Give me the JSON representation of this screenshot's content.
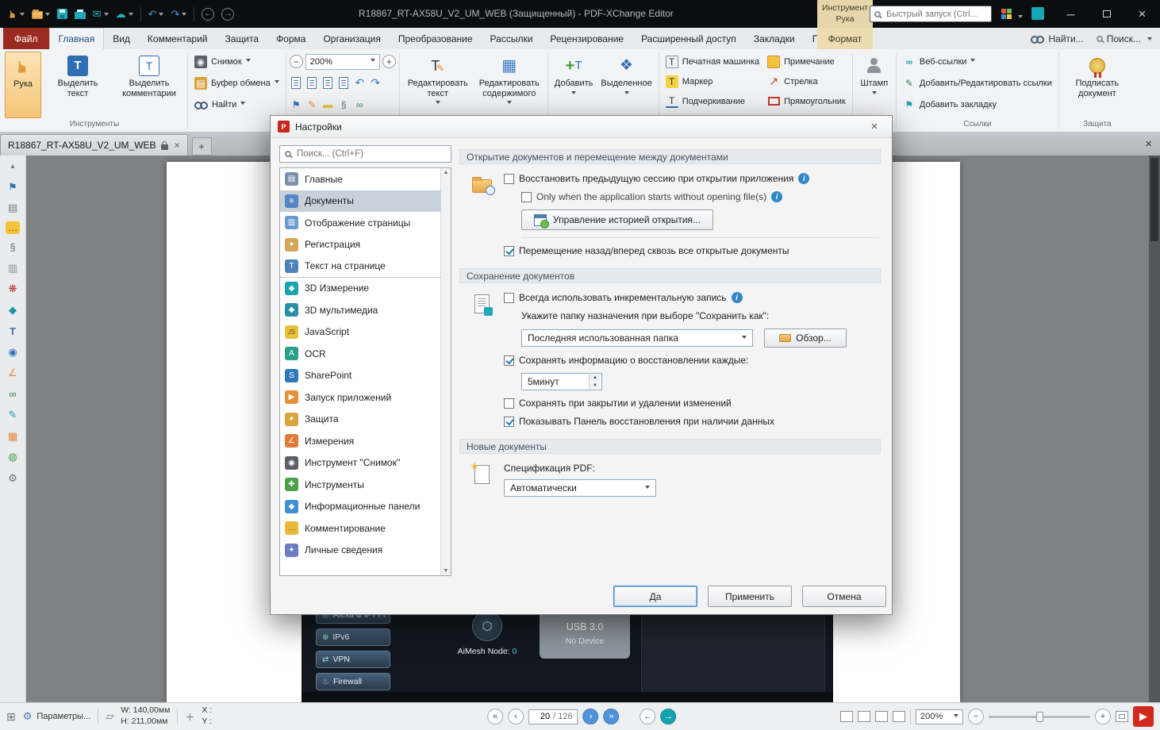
{
  "titlebar": {
    "title": "R18867_RT-AX58U_V2_UM_WEB (Защищенный) - PDF-XChange Editor",
    "quick_search_placeholder": "Быстрый запуск (Ctrl...",
    "context_group_line1": "Инструмент",
    "context_group_line2": "Рука"
  },
  "tabs": {
    "items": [
      {
        "label": "Файл"
      },
      {
        "label": "Главная"
      },
      {
        "label": "Вид"
      },
      {
        "label": "Комментарий"
      },
      {
        "label": "Защита"
      },
      {
        "label": "Форма"
      },
      {
        "label": "Организация"
      },
      {
        "label": "Преобразование"
      },
      {
        "label": "Рассылки"
      },
      {
        "label": "Рецензирование"
      },
      {
        "label": "Расширенный доступ"
      },
      {
        "label": "Закладки"
      },
      {
        "label": "Помощь"
      }
    ],
    "format_tab": "Формат",
    "find": "Найти...",
    "search": "Поиск..."
  },
  "ribbon": {
    "hand": "Рука",
    "select_text": "Выделить текст",
    "select_comments": "Выделить комментарии",
    "group_tools": "Инструменты",
    "snapshot": "Снимок",
    "clipboard": "Буфер обмена",
    "find": "Найти",
    "zoom_value": "200%",
    "edit_text": "Редактировать текст",
    "edit_content": "Редактировать содержимого",
    "add": "Добавить",
    "selected": "Выделенное",
    "typewriter": "Печатная машинка",
    "highlight": "Маркер",
    "underline": "Подчеркивание",
    "note": "Примечание",
    "arrow": "Стрелка",
    "rectangle": "Прямоугольник",
    "stamp": "Штамп",
    "web_links": "Веб-ссылки",
    "add_edit_links": "Добавить/Редактировать ссылки",
    "add_bookmark": "Добавить закладку",
    "group_links": "Ссылки",
    "sign_document": "Подписать документ",
    "group_protect": "Защита"
  },
  "doctab": {
    "title": "R18867_RT-AX58U_V2_UM_WEB"
  },
  "dialog": {
    "title": "Настройки",
    "search_placeholder": "Поиск... (Ctrl+F)",
    "categories": [
      {
        "label": "Главные"
      },
      {
        "label": "Документы",
        "selected": true
      },
      {
        "label": "Отображение страницы"
      },
      {
        "label": "Регистрация"
      },
      {
        "label": "Текст на странице"
      },
      {
        "label": "3D Измерение"
      },
      {
        "label": "3D мультимедиа"
      },
      {
        "label": "JavaScript"
      },
      {
        "label": "OCR"
      },
      {
        "label": "SharePoint"
      },
      {
        "label": "Запуск приложений"
      },
      {
        "label": "Защита"
      },
      {
        "label": "Измерения"
      },
      {
        "label": "Инструмент \"Снимок\""
      },
      {
        "label": "Инструменты"
      },
      {
        "label": "Информационные панели"
      },
      {
        "label": "Комментирование"
      },
      {
        "label": "Личные сведения"
      }
    ],
    "open_section": {
      "title": "Открытие документов и перемещение между документами",
      "restore_session": {
        "label": "Восстановить предыдущую сессию при открытии приложения",
        "checked": false
      },
      "only_when": {
        "label": "Only when the application starts without opening file(s)",
        "checked": false
      },
      "manage_history": "Управление историей открытия...",
      "navigate_all": {
        "label": "Перемещение назад/вперед сквозь все открытые документы",
        "checked": true
      }
    },
    "save_section": {
      "title": "Сохранение документов",
      "incremental": {
        "label": "Всегда использовать инкрементальную запись",
        "checked": false
      },
      "dest_label": "Укажите папку назначения при выборе \"Сохранить как\":",
      "dest_value": "Последняя использованная папка",
      "browse": "Обзор...",
      "autosave": {
        "label": "Сохранять информацию о восстановлении каждые:",
        "checked": true
      },
      "interval_value": "5минут",
      "save_on_close": {
        "label": "Сохранять при закрытии и удалении изменений",
        "checked": false
      },
      "show_recovery": {
        "label": "Показывать Панель восстановления при наличии данных",
        "checked": true
      }
    },
    "new_section": {
      "title": "Новые документы",
      "spec_label": "Спецификация PDF:",
      "spec_value": "Автоматически"
    },
    "buttons": {
      "ok": "Да",
      "apply": "Применить",
      "cancel": "Отмена"
    }
  },
  "pdfpage": {
    "menu": [
      {
        "label": "Alexa & IFTTT"
      },
      {
        "label": "IPv6"
      },
      {
        "label": "VPN"
      },
      {
        "label": "Firewall"
      }
    ],
    "aimesh_label": "AiMesh Node:",
    "aimesh_value": "0",
    "usb_title": "USB 3.0",
    "usb_status": "No Device"
  },
  "statusbar": {
    "options": "Параметры...",
    "width": "W: 140,00мм",
    "height": "H: 211,00мм",
    "x": "X :",
    "y": "Y :",
    "page_current": "20",
    "page_total": "/ 126",
    "zoom": "200%"
  }
}
